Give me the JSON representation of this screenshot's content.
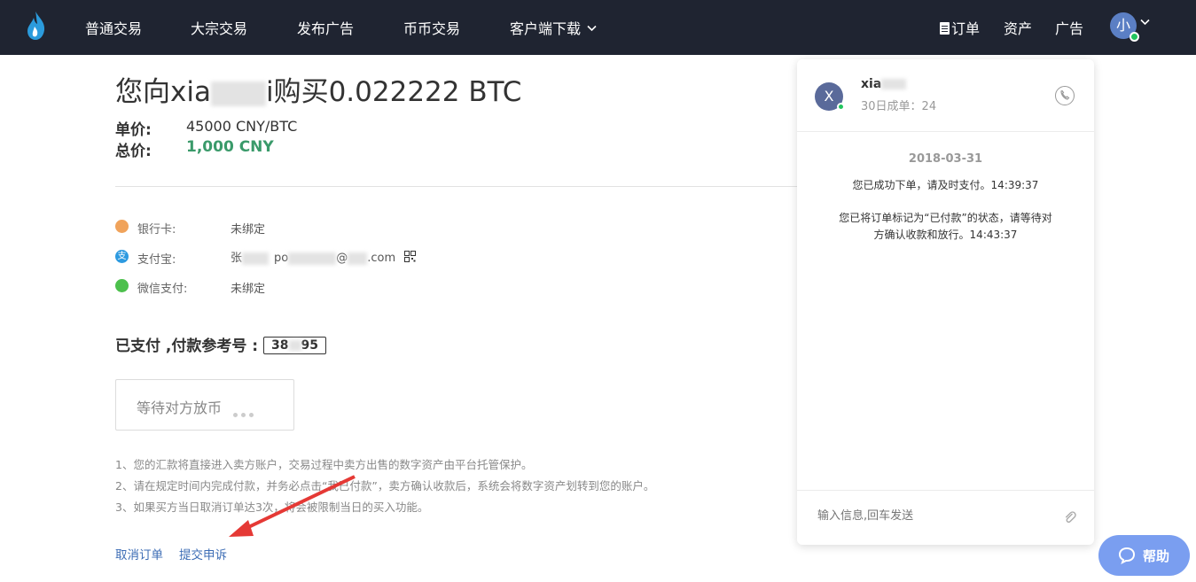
{
  "nav": {
    "items": [
      "普通交易",
      "大宗交易",
      "发布广告",
      "币币交易",
      "客户端下载"
    ],
    "orders": "订单",
    "assets": "资产",
    "ads": "广告",
    "avatar": "小"
  },
  "order": {
    "title_prefix": "您向xia",
    "title_suffix": "i购买0.022222 BTC",
    "unit_price_label": "单价:",
    "unit_price": "45000 CNY/BTC",
    "total_label": "总价:",
    "total": "1,000 CNY"
  },
  "payment": {
    "bank_label": "银行卡:",
    "bank_value": "未绑定",
    "alipay_label": "支付宝:",
    "alipay_name": "张",
    "alipay_account_prefix": "po",
    "alipay_account_suffix": "@",
    "alipay_domain": ".com",
    "wechat_label": "微信支付:",
    "wechat_value": "未绑定"
  },
  "status": {
    "paid_label": "已支付 ,付款参考号 :",
    "ref_prefix": "38",
    "ref_suffix": "95",
    "waiting": "等待对方放币"
  },
  "notes": [
    "1、您的汇款将直接进入卖方账户，交易过程中卖方出售的数字资产由平台托管保护。",
    "2、请在规定时间内完成付款，并务必点击“我已付款”，卖方确认收款后，系统会将数字资产划转到您的账户。",
    "3、如果买方当日取消订单达3次，将会被限制当日的买入功能。"
  ],
  "actions": {
    "cancel": "取消订单",
    "appeal": "提交申诉"
  },
  "chat": {
    "avatar": "X",
    "name": "xia",
    "sub": "30日成单：24",
    "date": "2018-03-31",
    "msg1": "您已成功下单，请及时支付。14:39:37",
    "msg2_line1": "您已将订单标记为“已付款”的状态，请等待对",
    "msg2_line2": "方确认收款和放行。14:43:37",
    "input_placeholder": "输入信息,回车发送"
  },
  "help": {
    "label": "帮助"
  },
  "colors": {
    "topbar": "#1f2431",
    "accent_green": "#3a9a6a",
    "link": "#3d6db5",
    "help_bg": "#7a9ef0"
  }
}
